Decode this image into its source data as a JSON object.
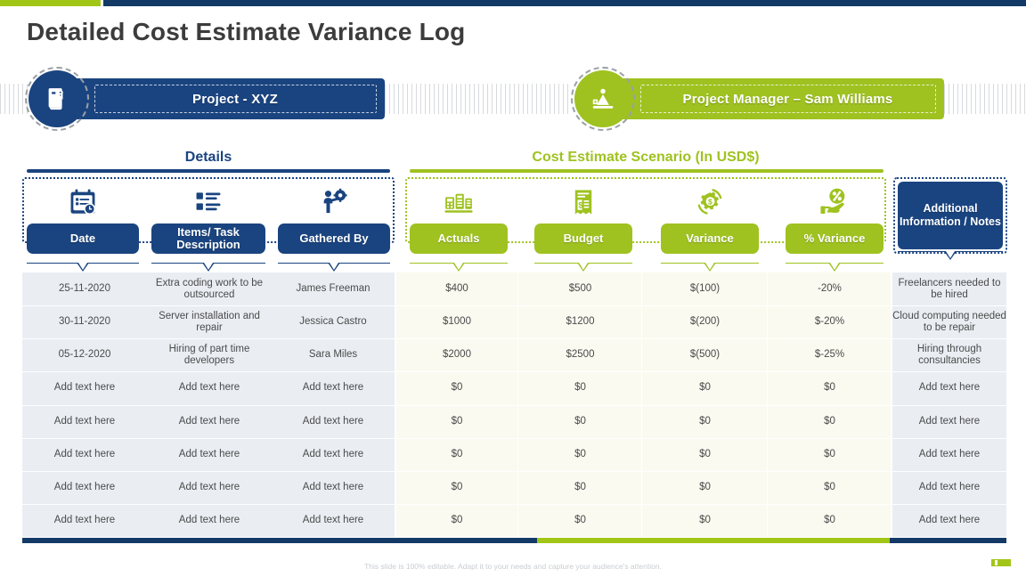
{
  "theme": {
    "navy": "#1A4480",
    "navy_dark": "#133A66",
    "green": "#9FC220",
    "green_dark": "#A2C617",
    "left_band": "#EAEEF3",
    "mid_band": "#FAFAF0"
  },
  "page_title": "Detailed Cost Estimate Variance Log",
  "banners": {
    "project": {
      "label": "Project - XYZ",
      "icon": "document-badge-icon"
    },
    "manager": {
      "label": "Project Manager – Sam Williams",
      "icon": "person-presentation-icon"
    }
  },
  "groups": {
    "details": {
      "title": "Details"
    },
    "scenario": {
      "title": "Cost Estimate Scenario (In USD$)"
    }
  },
  "columns": [
    {
      "key": "date",
      "label": "Date",
      "icon": "calendar-clock-icon",
      "style": "navy"
    },
    {
      "key": "items",
      "label": "Items/ Task Description",
      "icon": "task-list-icon",
      "style": "navy"
    },
    {
      "key": "gathered_by",
      "label": "Gathered By",
      "icon": "person-gear-icon",
      "style": "navy"
    },
    {
      "key": "actuals",
      "label": "Actuals",
      "icon": "calculator-data-icon",
      "style": "green"
    },
    {
      "key": "budget",
      "label": "Budget",
      "icon": "invoice-dollar-icon",
      "style": "green"
    },
    {
      "key": "variance",
      "label": "Variance",
      "icon": "gear-dollar-icon",
      "style": "green"
    },
    {
      "key": "pct_var",
      "label": "% Variance",
      "icon": "hand-percent-icon",
      "style": "green"
    }
  ],
  "notes_column": {
    "label": "Additional Information / Notes",
    "style": "navy"
  },
  "rows": [
    {
      "date": "25-11-2020",
      "items": "Extra coding work to be outsourced",
      "gathered_by": "James Freeman",
      "actuals": "$400",
      "budget": "$500",
      "variance": "$(100)",
      "pct_var": "-20%",
      "notes": "Freelancers needed to be hired"
    },
    {
      "date": "30-11-2020",
      "items": "Server installation and repair",
      "gathered_by": "Jessica Castro",
      "actuals": "$1000",
      "budget": "$1200",
      "variance": "$(200)",
      "pct_var": "$-20%",
      "notes": "Cloud computing needed to be repair"
    },
    {
      "date": "05-12-2020",
      "items": "Hiring of part time developers",
      "gathered_by": "Sara Miles",
      "actuals": "$2000",
      "budget": "$2500",
      "variance": "$(500)",
      "pct_var": "$-25%",
      "notes": "Hiring through consultancies"
    },
    {
      "date": "Add text here",
      "items": "Add text here",
      "gathered_by": "Add text here",
      "actuals": "$0",
      "budget": "$0",
      "variance": "$0",
      "pct_var": "$0",
      "notes": "Add text here"
    },
    {
      "date": "Add text here",
      "items": "Add text here",
      "gathered_by": "Add text here",
      "actuals": "$0",
      "budget": "$0",
      "variance": "$0",
      "pct_var": "$0",
      "notes": "Add text here"
    },
    {
      "date": "Add text here",
      "items": "Add text here",
      "gathered_by": "Add text here",
      "actuals": "$0",
      "budget": "$0",
      "variance": "$0",
      "pct_var": "$0",
      "notes": "Add text here"
    },
    {
      "date": "Add text here",
      "items": "Add text here",
      "gathered_by": "Add text here",
      "actuals": "$0",
      "budget": "$0",
      "variance": "$0",
      "pct_var": "$0",
      "notes": "Add text here"
    },
    {
      "date": "Add text here",
      "items": "Add text here",
      "gathered_by": "Add text here",
      "actuals": "$0",
      "budget": "$0",
      "variance": "$0",
      "pct_var": "$0",
      "notes": "Add text here"
    }
  ],
  "footer": {
    "note": "This slide is 100% editable. Adapt it to your needs and capture your audience's attention."
  }
}
